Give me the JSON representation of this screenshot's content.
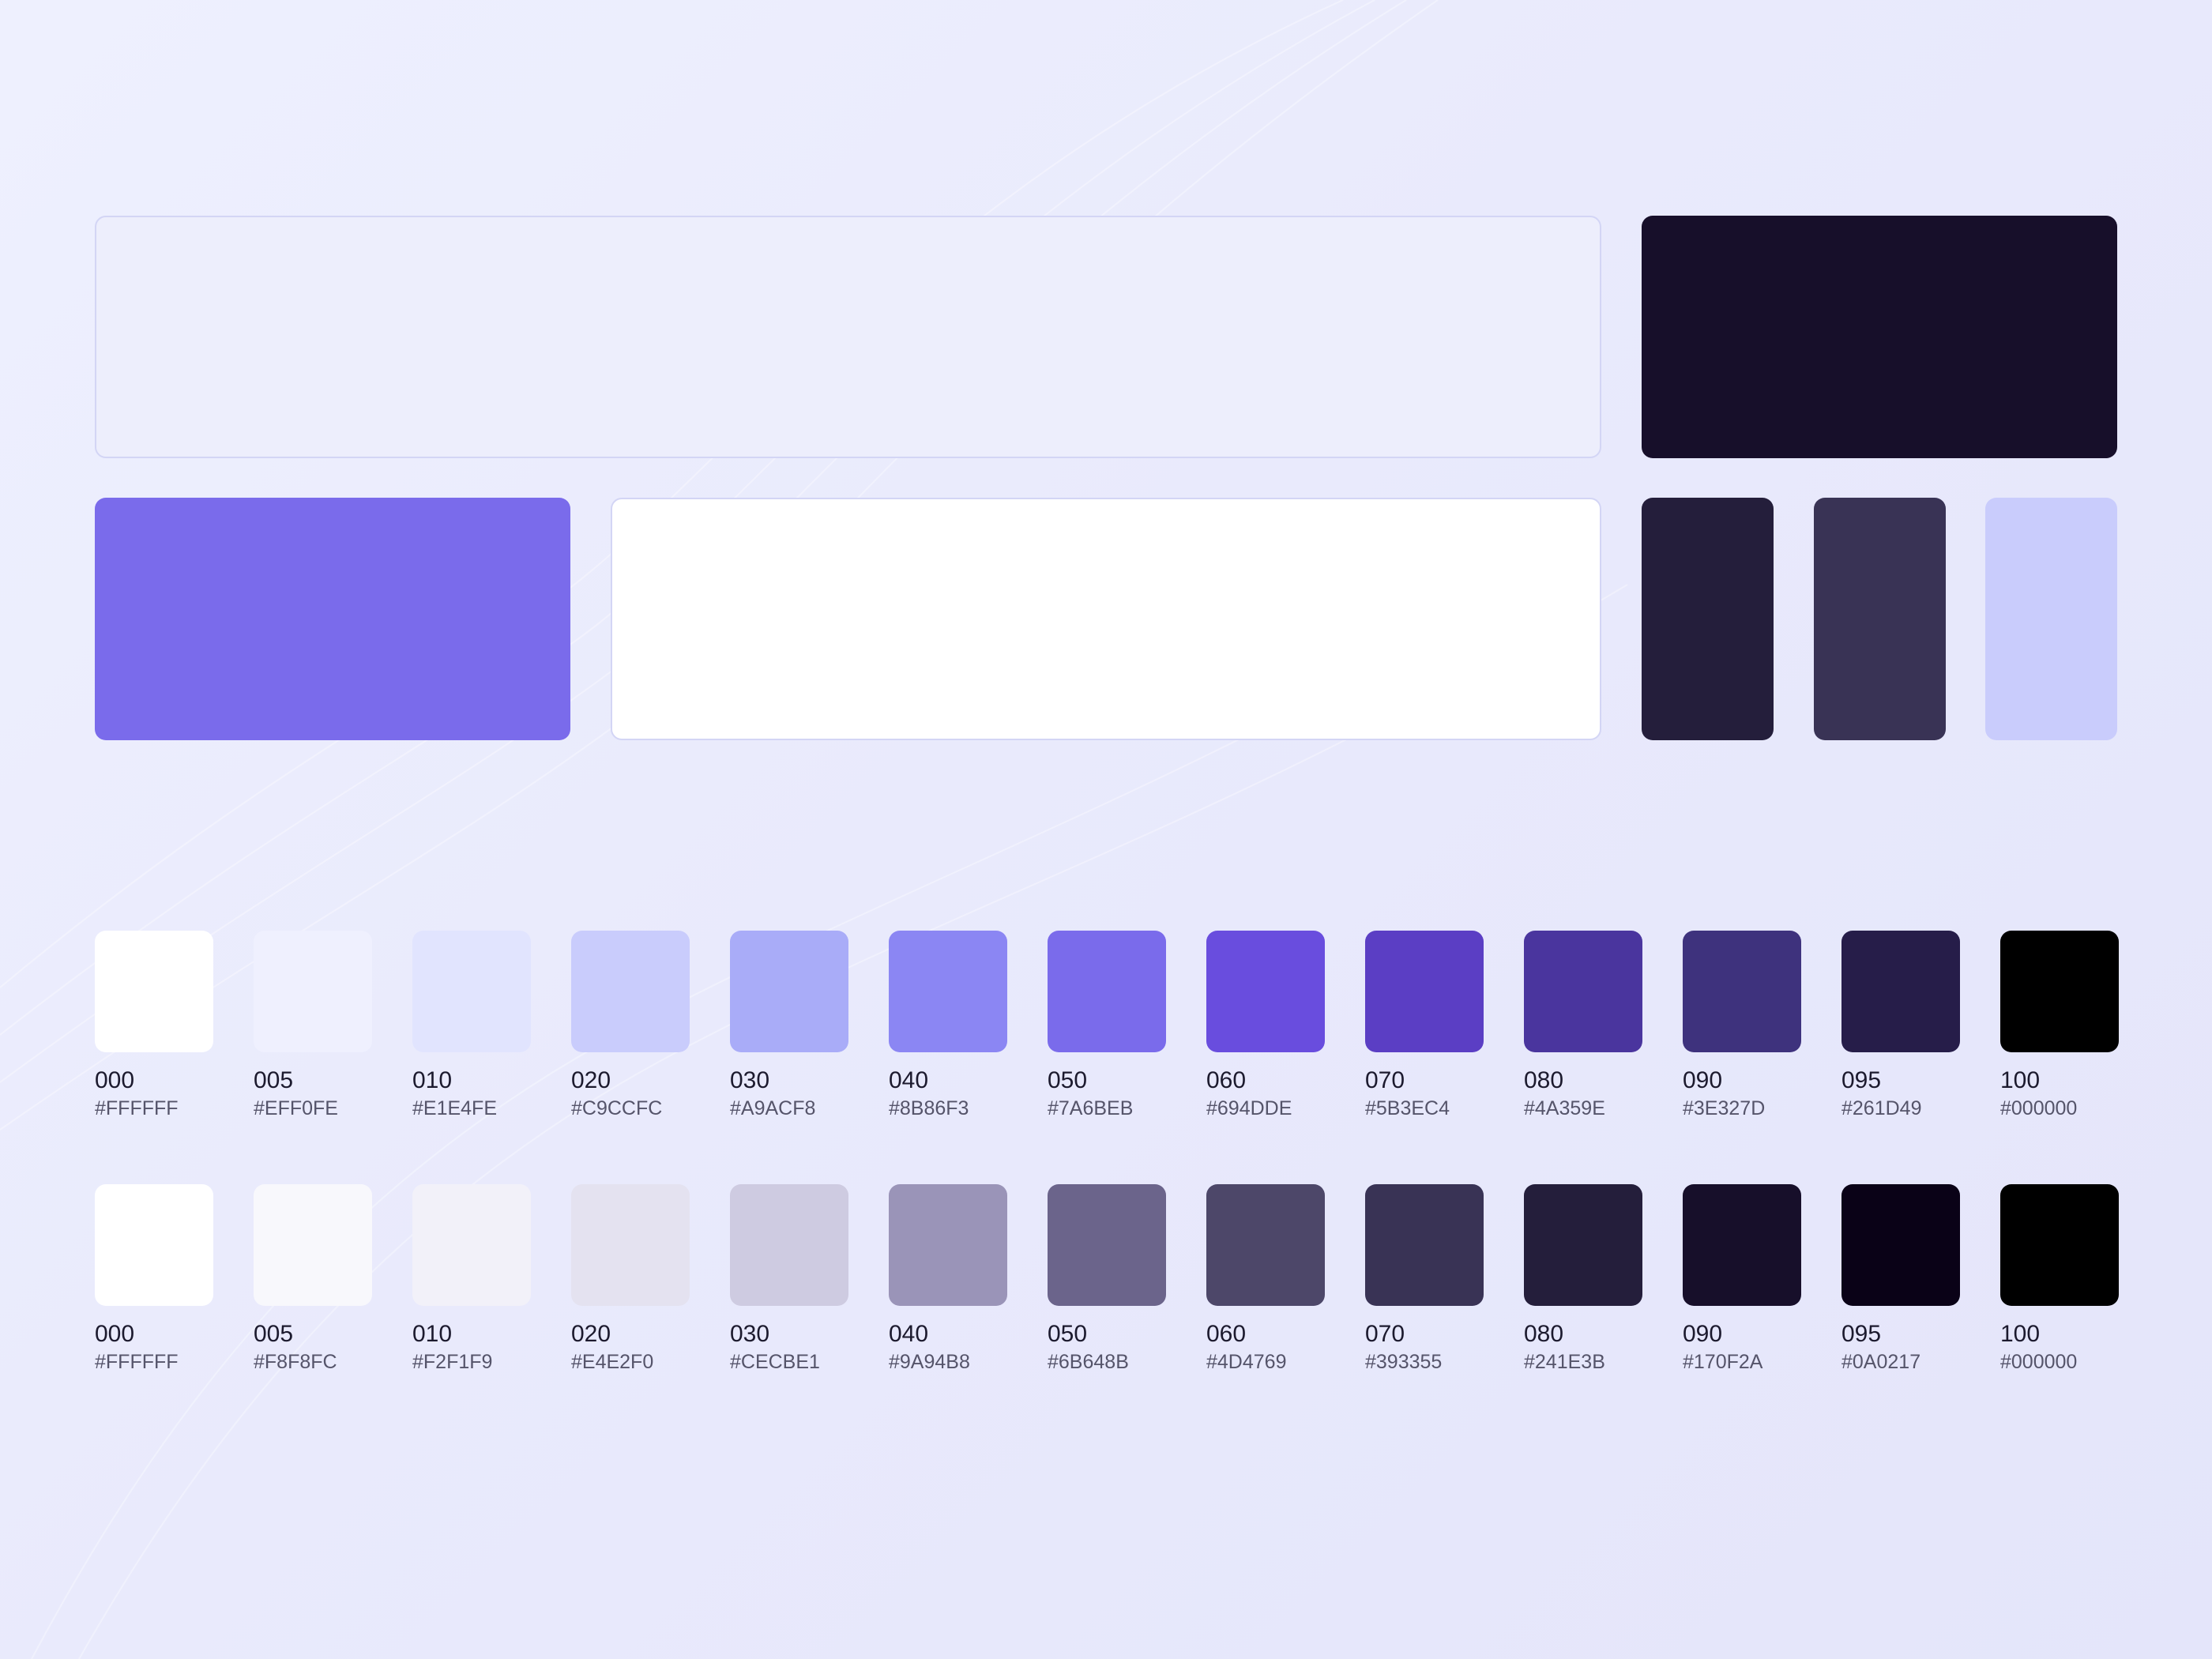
{
  "palette_blocks": [
    {
      "name": "block-light",
      "color": "#EDEEFC",
      "outlined": true
    },
    {
      "name": "block-darkest",
      "color": "#170F2A",
      "outlined": false
    },
    {
      "name": "block-primary",
      "color": "#7A6BEB",
      "outlined": false
    },
    {
      "name": "block-white",
      "color": "#FFFFFF",
      "outlined": true
    },
    {
      "name": "block-dark",
      "color": "#241E3B",
      "outlined": false
    },
    {
      "name": "block-mid",
      "color": "#393355",
      "outlined": false
    },
    {
      "name": "block-lavender",
      "color": "#C9CCFC",
      "outlined": false
    }
  ],
  "primary_scale": [
    {
      "code": "000",
      "hex": "#FFFFFF",
      "color": "#FFFFFF"
    },
    {
      "code": "005",
      "hex": "#EFF0FE",
      "color": "#EFF0FE"
    },
    {
      "code": "010",
      "hex": "#E1E4FE",
      "color": "#E1E4FE"
    },
    {
      "code": "020",
      "hex": "#C9CCFC",
      "color": "#C9CCFC"
    },
    {
      "code": "030",
      "hex": "#A9ACF8",
      "color": "#A9ACF8"
    },
    {
      "code": "040",
      "hex": "#8B86F3",
      "color": "#8B86F3"
    },
    {
      "code": "050",
      "hex": "#7A6BEB",
      "color": "#7A6BEB"
    },
    {
      "code": "060",
      "hex": "#694DDE",
      "color": "#694DDE"
    },
    {
      "code": "070",
      "hex": "#5B3EC4",
      "color": "#5B3EC4"
    },
    {
      "code": "080",
      "hex": "#4A359E",
      "color": "#4A359E"
    },
    {
      "code": "090",
      "hex": "#3E327D",
      "color": "#3E327D"
    },
    {
      "code": "095",
      "hex": "#261D49",
      "color": "#261D49"
    },
    {
      "code": "100",
      "hex": "#000000",
      "color": "#000000"
    }
  ],
  "neutral_scale": [
    {
      "code": "000",
      "hex": "#FFFFFF",
      "color": "#FFFFFF"
    },
    {
      "code": "005",
      "hex": "#F8F8FC",
      "color": "#F8F8FC"
    },
    {
      "code": "010",
      "hex": "#F2F1F9",
      "color": "#F2F1F9"
    },
    {
      "code": "020",
      "hex": "#E4E2F0",
      "color": "#E4E2F0"
    },
    {
      "code": "030",
      "hex": "#CECBE1",
      "color": "#CECBE1"
    },
    {
      "code": "040",
      "hex": "#9A94B8",
      "color": "#9A94B8"
    },
    {
      "code": "050",
      "hex": "#6B648B",
      "color": "#6B648B"
    },
    {
      "code": "060",
      "hex": "#4D4769",
      "color": "#4D4769"
    },
    {
      "code": "070",
      "hex": "#393355",
      "color": "#393355"
    },
    {
      "code": "080",
      "hex": "#241E3B",
      "color": "#241E3B"
    },
    {
      "code": "090",
      "hex": "#170F2A",
      "color": "#170F2A"
    },
    {
      "code": "095",
      "hex": "#0A0217",
      "color": "#0A0217"
    },
    {
      "code": "100",
      "hex": "#000000",
      "color": "#000000"
    }
  ]
}
